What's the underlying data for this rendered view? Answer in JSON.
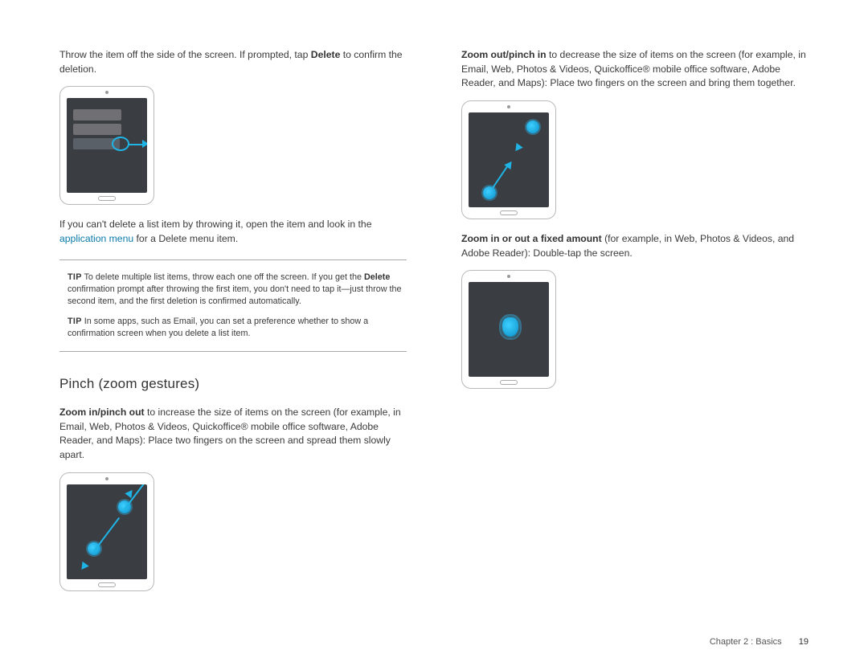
{
  "left": {
    "p1_pre": "Throw the item off the side of the screen. If prompted, tap ",
    "p1_bold": "Delete",
    "p1_post": " to confirm the deletion.",
    "p2_pre": "If you can't delete a list item by throwing it, open the item and look in the ",
    "p2_link": "application menu",
    "p2_post": " for a Delete menu item.",
    "tip1_label": "TIP",
    "tip1_text_pre": " To delete multiple list items, throw each one off the screen. If you get the ",
    "tip1_bold": "Delete",
    "tip1_text_post": " confirmation prompt after throwing the first item, you don't need to tap it—just throw the second item, and the first deletion is confirmed automatically.",
    "tip2_label": "TIP",
    "tip2_text": " In some apps, such as Email, you can set a preference whether to show a confirmation screen when you delete a list item.",
    "heading": "Pinch (zoom gestures)",
    "p3_bold": "Zoom in/pinch out",
    "p3_text": " to increase the size of items on the screen (for example, in Email, Web, Photos & Videos, Quickoffice® mobile office software, Adobe Reader, and Maps): Place two fingers on the screen and spread them slowly apart."
  },
  "right": {
    "p1_bold": "Zoom out/pinch in",
    "p1_text": " to decrease the size of items on the screen (for example, in Email, Web, Photos & Videos, Quickoffice® mobile office software, Adobe Reader, and Maps): Place two fingers on the screen and bring them together.",
    "p2_bold": "Zoom in or out a fixed amount",
    "p2_text": " (for example, in Web, Photos & Videos, and Adobe Reader): Double-tap the screen."
  },
  "footer": {
    "chapter": "Chapter 2 : Basics",
    "page": "19"
  }
}
